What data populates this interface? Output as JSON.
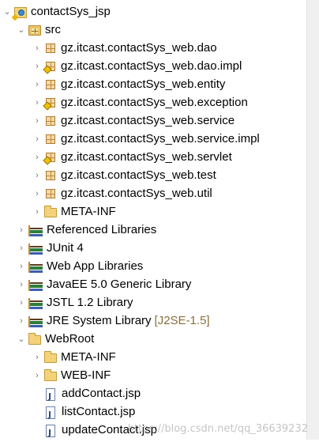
{
  "project": {
    "label": "contactSys_jsp"
  },
  "src": {
    "label": "src",
    "packages": [
      {
        "label": "gz.itcast.contactSys_web.dao",
        "warning": false
      },
      {
        "label": "gz.itcast.contactSys_web.dao.impl",
        "warning": true
      },
      {
        "label": "gz.itcast.contactSys_web.entity",
        "warning": false
      },
      {
        "label": "gz.itcast.contactSys_web.exception",
        "warning": true
      },
      {
        "label": "gz.itcast.contactSys_web.service",
        "warning": false
      },
      {
        "label": "gz.itcast.contactSys_web.service.impl",
        "warning": false
      },
      {
        "label": "gz.itcast.contactSys_web.servlet",
        "warning": true
      },
      {
        "label": "gz.itcast.contactSys_web.test",
        "warning": false
      },
      {
        "label": "gz.itcast.contactSys_web.util",
        "warning": false
      }
    ],
    "meta_inf": "META-INF"
  },
  "libraries": [
    {
      "label": "Referenced Libraries"
    },
    {
      "label": "JUnit 4"
    },
    {
      "label": "Web App Libraries"
    },
    {
      "label": "JavaEE 5.0 Generic Library"
    },
    {
      "label": "JSTL 1.2 Library"
    },
    {
      "label": "JRE System Library",
      "decorator": "[J2SE-1.5]"
    }
  ],
  "webroot": {
    "label": "WebRoot",
    "folders": [
      {
        "label": "META-INF"
      },
      {
        "label": "WEB-INF"
      }
    ],
    "files": [
      {
        "label": "addContact.jsp"
      },
      {
        "label": "listContact.jsp"
      },
      {
        "label": "updateContact.jsp"
      }
    ]
  },
  "watermark": "https://blog.csdn.net/qq_36639232",
  "colors": {
    "decorator": "#8a6d3b",
    "background": "#ffffff"
  }
}
